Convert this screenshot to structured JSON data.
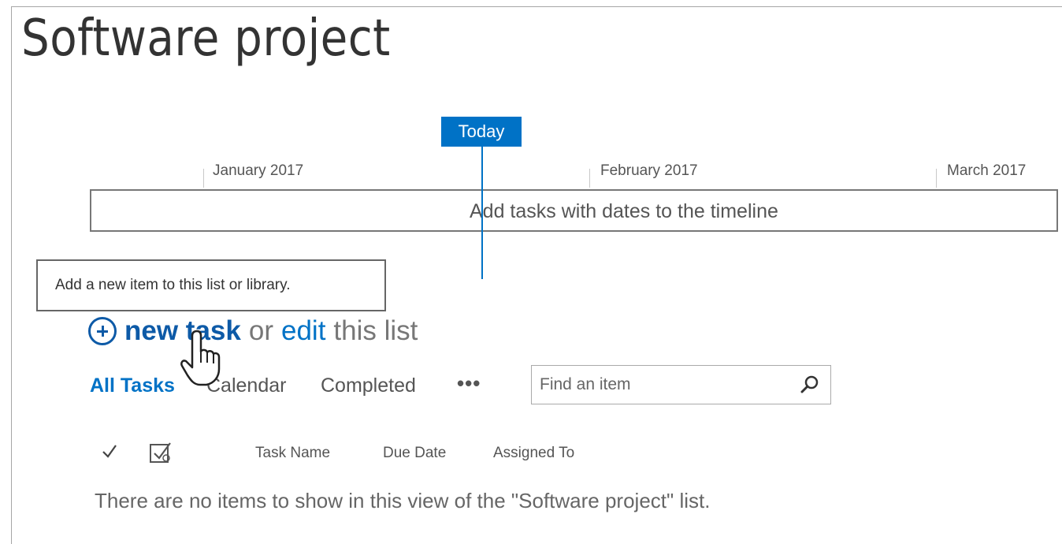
{
  "page": {
    "title": "Software project"
  },
  "timeline": {
    "today_label": "Today",
    "months": [
      "January 2017",
      "February 2017",
      "March 2017"
    ],
    "empty_message": "Add tasks with dates to the timeline"
  },
  "tooltip": {
    "text": "Add a new item to this list or library."
  },
  "actions": {
    "new_task": "new task",
    "or": "or",
    "edit": "edit",
    "this_list": "this list"
  },
  "views": {
    "tabs": [
      "All Tasks",
      "Calendar",
      "Completed"
    ],
    "active": "All Tasks",
    "more": "•••"
  },
  "search": {
    "placeholder": "Find an item"
  },
  "columns": {
    "headers": [
      "Task Name",
      "Due Date",
      "Assigned To"
    ]
  },
  "list": {
    "empty_message": "There are no items to show in this view of the \"Software project\" list."
  },
  "colors": {
    "accent": "#0072c6",
    "link_dark": "#0d5aa7"
  }
}
